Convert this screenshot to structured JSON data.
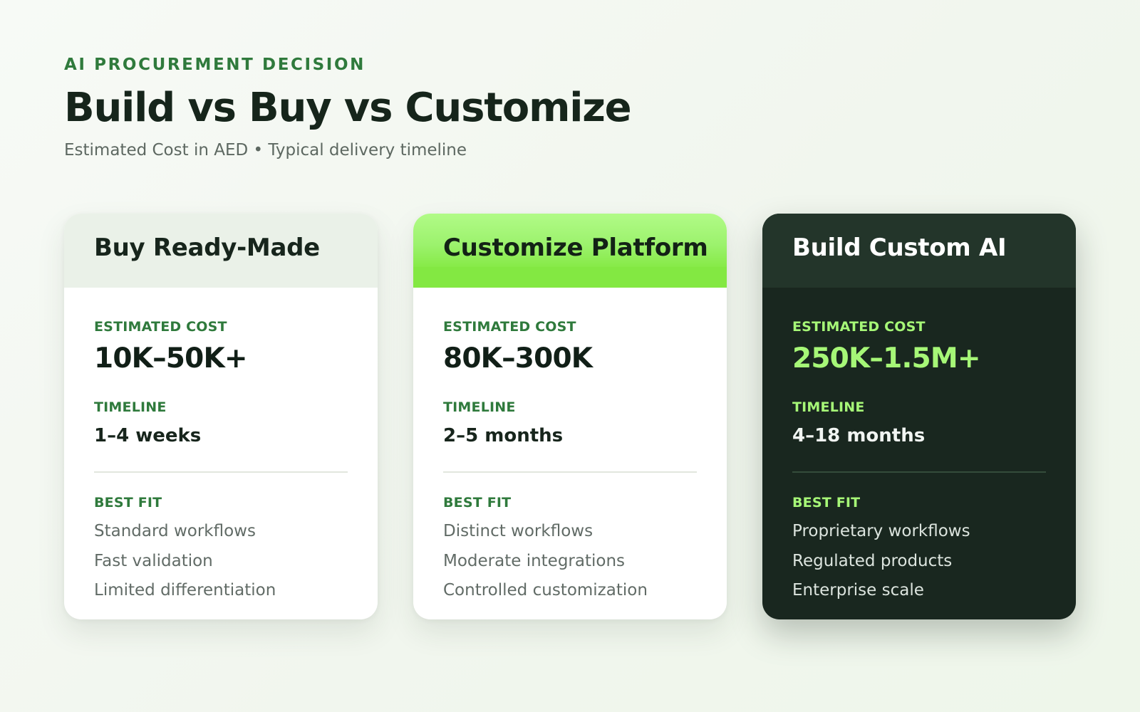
{
  "header": {
    "eyebrow": "AI PROCUREMENT DECISION",
    "title": "Build vs Buy vs Customize",
    "subtitle": "Estimated Cost in AED • Typical delivery timeline"
  },
  "cards": [
    {
      "title": "Buy Ready-Made",
      "cost_label": "ESTIMATED COST",
      "cost": "10K–50K+",
      "timeline_label": "TIMELINE",
      "timeline": "1–4 weeks",
      "fit_label": "BEST FIT",
      "fit_items": [
        "Standard workflows",
        "Fast validation",
        "Limited differentiation"
      ]
    },
    {
      "title": "Customize Platform",
      "cost_label": "ESTIMATED COST",
      "cost": "80K–300K",
      "timeline_label": "TIMELINE",
      "timeline": "2–5 months",
      "fit_label": "BEST FIT",
      "fit_items": [
        "Distinct workflows",
        "Moderate integrations",
        "Controlled customization"
      ]
    },
    {
      "title": "Build Custom AI",
      "cost_label": "ESTIMATED COST",
      "cost": "250K–1.5M+",
      "timeline_label": "TIMELINE",
      "timeline": "4–18 months",
      "fit_label": "BEST FIT",
      "fit_items": [
        "Proprietary workflows",
        "Regulated products",
        "Enterprise scale"
      ]
    }
  ],
  "colors": {
    "accent_green": "#2f7a3c",
    "highlight_lime": "#86ea46",
    "dark_card": "#19271f",
    "dark_header": "#23352a",
    "light_header": "#eaf1e8"
  }
}
